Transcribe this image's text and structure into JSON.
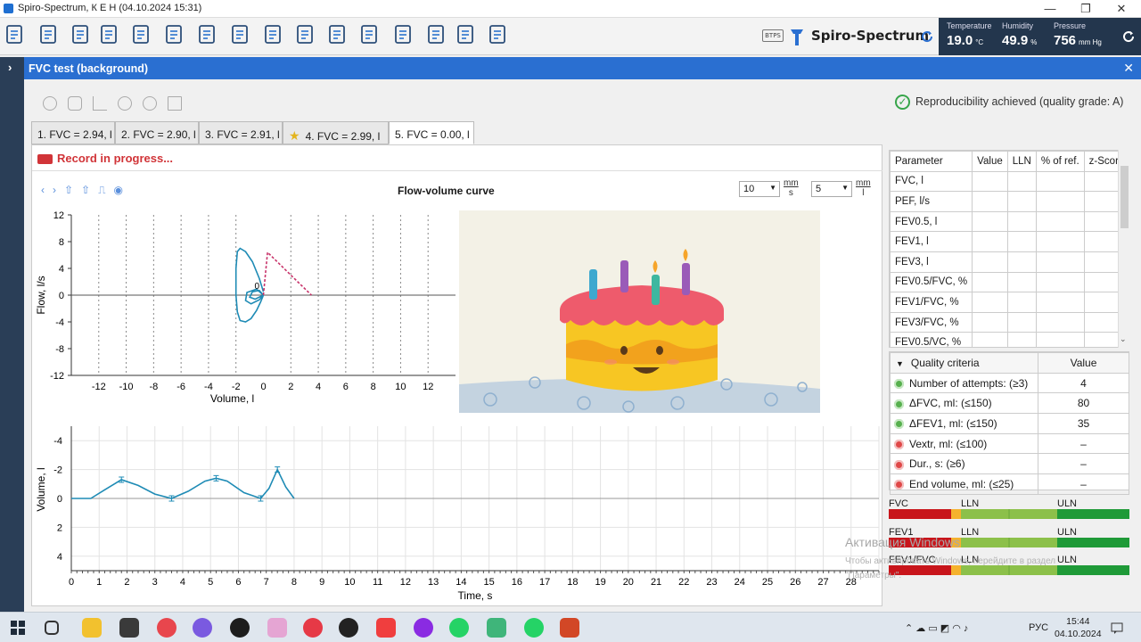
{
  "window": {
    "title": "Spiro-Spectrum, К Е Н (04.10.2024 15:31)",
    "minimize": "—",
    "maximize": "❐",
    "close": "✕"
  },
  "toolbar": {
    "icons": [
      "patient-card-icon",
      "upload-icon",
      "probe-icon",
      "save-icon",
      "lungs-icon",
      "head-icon",
      "head-test-icon",
      "lungs-filter-icon",
      "fan-icon",
      "report-icon",
      "document-icon",
      "trend-icon",
      "download-icon",
      "export-icon",
      "settings-icon",
      "info-icon"
    ],
    "btps": "BTPS",
    "brand": "Spiro-Spectrum"
  },
  "environment": {
    "temperature": {
      "label": "Temperature",
      "value": "19.0",
      "unit": "°C"
    },
    "humidity": {
      "label": "Humidity",
      "value": "49.9",
      "unit": "%"
    },
    "pressure": {
      "label": "Pressure",
      "value": "756",
      "unit": "mm Hg"
    }
  },
  "panel": {
    "title": "FVC test (background)",
    "close": "✕",
    "expand": "›"
  },
  "reproducibility": "Reproducibility achieved (quality grade: A)",
  "tabs": [
    {
      "label": "1. FVC = 2.94, l",
      "star": false
    },
    {
      "label": "2. FVC = 2.90, l",
      "star": false
    },
    {
      "label": "3. FVC = 2.91, l",
      "star": false
    },
    {
      "label": "4. FVC = 2.99, l",
      "star": true
    },
    {
      "label": "5. FVC = 0.00, l",
      "star": false,
      "active": true
    }
  ],
  "record_status": "Record in progress...",
  "flow_chart": {
    "title": "Flow-volume curve",
    "scale1": "10",
    "scale1_unit_top": "mm",
    "scale1_unit_bottom": "s",
    "scale2": "5",
    "scale2_unit_top": "mm",
    "scale2_unit_bottom": "l",
    "zero_label": "0"
  },
  "chart_data": [
    {
      "type": "line",
      "xlabel": "Volume, l",
      "ylabel": "Flow, l/s",
      "xlim": [
        -14,
        14
      ],
      "ylim": [
        -12,
        12
      ],
      "xticks": [
        -12,
        -10,
        -8,
        -6,
        -4,
        -2,
        0,
        2,
        4,
        6,
        8,
        10,
        12
      ],
      "yticks": [
        12,
        8,
        4,
        0,
        -4,
        -8,
        -12
      ],
      "series": [
        {
          "name": "",
          "color": "#1e8bb5",
          "x": [
            0,
            -0.3,
            -0.8,
            -1.3,
            -1.7,
            -1.9,
            -2.0,
            -2.0,
            -1.9,
            -1.7,
            -1.3,
            -0.9,
            -0.5,
            -0.2,
            0,
            -0.5,
            -1.2,
            -1.3,
            -0.9,
            -0.3,
            0,
            -0.6,
            -1.0,
            -0.8,
            -0.3,
            0
          ],
          "y": [
            0.5,
            2.5,
            5.0,
            6.5,
            7.0,
            6.5,
            4.0,
            0,
            -2.5,
            -3.8,
            -4.0,
            -3.5,
            -2.3,
            -1.0,
            0,
            0.9,
            0.4,
            -0.8,
            -1.3,
            -0.7,
            0,
            -0.6,
            -0.3,
            0.5,
            0.7,
            0
          ]
        },
        {
          "name": "",
          "color": "#c8336a",
          "dashed": true,
          "x": [
            0,
            0.3,
            3.5
          ],
          "y": [
            0,
            6.4,
            0
          ]
        }
      ]
    },
    {
      "type": "line",
      "xlabel": "Time, s",
      "ylabel": "Volume, l",
      "xlim": [
        0,
        29
      ],
      "ylim": [
        5,
        -5
      ],
      "xticks": [
        0,
        1,
        2,
        3,
        4,
        5,
        6,
        7,
        8,
        9,
        10,
        11,
        12,
        13,
        14,
        15,
        16,
        17,
        18,
        19,
        20,
        21,
        22,
        23,
        24,
        25,
        26,
        27,
        28
      ],
      "yticks": [
        -4,
        -2,
        0,
        2,
        4
      ],
      "series": [
        {
          "name": "",
          "color": "#1e8bb5",
          "x": [
            0,
            0.7,
            1.2,
            1.8,
            2.4,
            3.0,
            3.6,
            4.2,
            4.8,
            5.2,
            5.6,
            6.2,
            6.8,
            7.1,
            7.4,
            7.7,
            8.0
          ],
          "y": [
            0,
            0,
            -0.6,
            -1.3,
            -0.9,
            -0.3,
            0,
            -0.5,
            -1.2,
            -1.4,
            -1.2,
            -0.4,
            0,
            -0.7,
            -2.0,
            -0.8,
            0
          ],
          "markers_x": [
            1.8,
            3.6,
            5.2,
            6.8,
            7.4
          ]
        }
      ]
    }
  ],
  "parameters": {
    "headers": [
      "Parameter",
      "Value",
      "LLN",
      "% of ref.",
      "z-Score"
    ],
    "rows": [
      "FVC, l",
      "PEF, l/s",
      "FEV0.5, l",
      "FEV1, l",
      "FEV3, l",
      "FEV0.5/FVC, %",
      "FEV1/FVC, %",
      "FEV3/FVC, %",
      "FEV0.5/VC, %"
    ]
  },
  "quality": {
    "header_label": "Quality criteria",
    "header_value": "Value",
    "rows": [
      {
        "label": "Number of attempts: (≥3)",
        "value": "4",
        "ok": true
      },
      {
        "label": "ΔFVC, ml: (≤150)",
        "value": "80",
        "ok": true
      },
      {
        "label": "ΔFEV1, ml: (≤150)",
        "value": "35",
        "ok": true
      },
      {
        "label": "Vextr, ml: (≤100)",
        "value": "–",
        "ok": false
      },
      {
        "label": "Dur., s: (≥6)",
        "value": "–",
        "ok": false
      },
      {
        "label": "End volume, ml: (≤25)",
        "value": "–",
        "ok": false
      }
    ]
  },
  "norm_bars": [
    {
      "name": "FVC",
      "lln": "LLN",
      "uln": "ULN"
    },
    {
      "name": "FEV1",
      "lln": "LLN",
      "uln": "ULN"
    },
    {
      "name": "FEV1/FVC",
      "lln": "LLN",
      "uln": "ULN"
    }
  ],
  "watermark": {
    "line1": "Активация Windows",
    "line2": "Чтобы активировать Windows, перейдите в раздел",
    "line3": "\"Параметры\"."
  },
  "taskbar": {
    "lang": "РУС",
    "time": "15:44",
    "date": "04.10.2024"
  }
}
